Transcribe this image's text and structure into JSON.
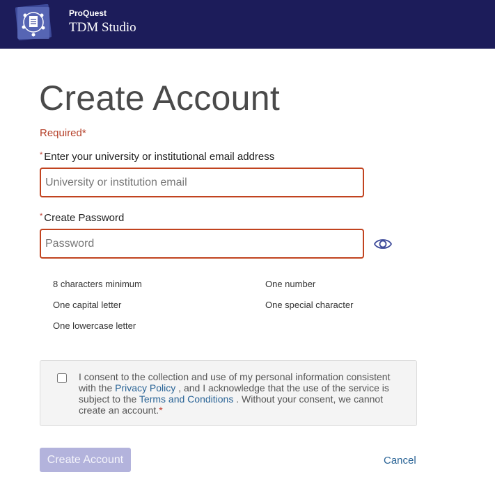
{
  "header": {
    "brand_small": "ProQuest",
    "brand_large": "TDM Studio",
    "logo_icon": "document-network-icon",
    "background_color": "#1c1c5a"
  },
  "form": {
    "title": "Create Account",
    "required_note": "Required",
    "required_marker": "*",
    "email": {
      "label": "Enter your university or institutional email address",
      "placeholder": "University or institution email",
      "value": ""
    },
    "password": {
      "label": "Create Password",
      "placeholder": "Password",
      "value": "",
      "toggle_icon": "eye-icon"
    },
    "password_requirements": [
      "8 characters minimum",
      "One number",
      "One capital letter",
      "One special character",
      "One lowercase letter"
    ],
    "consent": {
      "checked": false,
      "text_before": "I consent to the collection and use of my personal information consistent with the",
      "privacy_link": "Privacy Policy",
      "text_middle": ", and I acknowledge that the use of the service is subject to the",
      "terms_link": "Terms and Conditions",
      "text_after": ". Without your consent, we cannot create an account."
    },
    "submit_label": "Create Account",
    "cancel_label": "Cancel"
  },
  "colors": {
    "error_border": "#c1431f",
    "link": "#2a6496",
    "button_disabled": "#b3b3dc"
  }
}
